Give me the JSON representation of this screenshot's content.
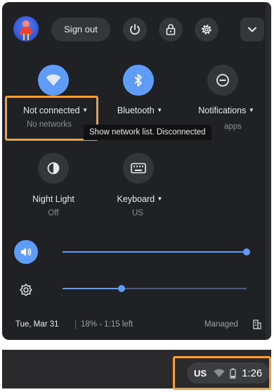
{
  "top_bar": {
    "sign_out_label": "Sign out"
  },
  "tiles": {
    "network": {
      "label": "Not connected",
      "sub": "No networks"
    },
    "bluetooth": {
      "label": "Bluetooth",
      "sub": ""
    },
    "notifications": {
      "label": "Notifications",
      "sub_visible": "apps"
    },
    "night_light": {
      "label": "Night Light",
      "sub": "Off"
    },
    "keyboard": {
      "label": "Keyboard",
      "sub": "US"
    }
  },
  "tooltip": {
    "text": "Show network list. Disconnected"
  },
  "sliders": {
    "volume": {
      "level": 1.0
    },
    "brightness": {
      "level": 0.32
    }
  },
  "footer": {
    "date": "Tue, Mar 31",
    "battery": "18% - 1:15 left",
    "managed": "Managed"
  },
  "shelf": {
    "ime": "US",
    "time": "1:26"
  },
  "colors": {
    "accent": "#5e9cf7",
    "highlight": "#f0a03c",
    "panel": "#202124"
  }
}
